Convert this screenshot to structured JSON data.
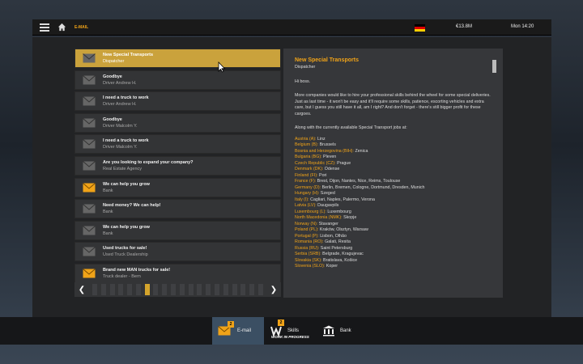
{
  "topbar": {
    "breadcrumb": "E-MAIL",
    "money": "€13.8M",
    "time": "Mon 14:20",
    "flag_colors": [
      "#000000",
      "#dd0000",
      "#ffce00"
    ]
  },
  "messages": [
    {
      "subject": "New Special Transports",
      "from": "Dispatcher",
      "status": "read",
      "selected": true
    },
    {
      "subject": "Goodbye",
      "from": "Driver Andrew H.",
      "status": "read"
    },
    {
      "subject": "I need a truck to work",
      "from": "Driver Andrew H.",
      "status": "read"
    },
    {
      "subject": "Goodbye",
      "from": "Driver Malcolm Y.",
      "status": "read"
    },
    {
      "subject": "I need a truck to work",
      "from": "Driver Malcolm Y.",
      "status": "read"
    },
    {
      "subject": "Are you looking to expand your company?",
      "from": "Real Estate Agency",
      "status": "read"
    },
    {
      "subject": "We can help you grow",
      "from": "Bank",
      "status": "new"
    },
    {
      "subject": "Need money? We can help!",
      "from": "Bank",
      "status": "read"
    },
    {
      "subject": "We can help you grow",
      "from": "Bank",
      "status": "read"
    },
    {
      "subject": "Used trucks for sale!",
      "from": "Used Truck Dealership",
      "status": "read"
    },
    {
      "subject": "Brand new MAN trucks for sale!",
      "from": "Truck dealer - Bern",
      "status": "new"
    }
  ],
  "pager": {
    "page_count": 20,
    "active_page": 6
  },
  "reader": {
    "title": "New Special Transports",
    "sender": "Dispatcher",
    "greeting": "Hi boss.",
    "body": "More companies would like to hire your professional skills behind the wheel for some special deliveries. Just as last time - it won't be easy and it'll require some skills, patience, escorting vehicles and extra care, but I guess you still have it all, am I right? And don't forget - there's still bigger profit for these cargoes.",
    "jobs_intro": "Along with the currently available Special Transport jobs at:",
    "jobs": [
      {
        "country": "Austria (A):",
        "cities": " Linz"
      },
      {
        "country": "Belgium (B):",
        "cities": " Brussels"
      },
      {
        "country": "Bosnia and Herzegovina (BIH):",
        "cities": " Zenica"
      },
      {
        "country": "Bulgaria (BG):",
        "cities": " Pleven"
      },
      {
        "country": "Czech Republic (CZ):",
        "cities": " Prague"
      },
      {
        "country": "Denmark (DK):",
        "cities": " Odense"
      },
      {
        "country": "Finland (FI):",
        "cities": " Pori"
      },
      {
        "country": "France (F):",
        "cities": " Brest, Dijon, Nantes, Nice, Reims, Toulouse"
      },
      {
        "country": "Germany (D):",
        "cities": " Berlin, Bremen, Cologne, Dortmund, Dresden, Munich"
      },
      {
        "country": "Hungary (H):",
        "cities": " Szeged"
      },
      {
        "country": "Italy (I):",
        "cities": " Cagliari, Naples, Palermo, Verona"
      },
      {
        "country": "Latvia (LV):",
        "cities": " Daugavpils"
      },
      {
        "country": "Luxembourg (L):",
        "cities": " Luxembourg"
      },
      {
        "country": "North Macedonia (NMK):",
        "cities": " Skopje"
      },
      {
        "country": "Norway (N):",
        "cities": " Stavanger"
      },
      {
        "country": "Poland (PL):",
        "cities": " Kraków, Olsztyn, Warsaw"
      },
      {
        "country": "Portugal (P):",
        "cities": " Lisbon, Olhão"
      },
      {
        "country": "Romania (RO):",
        "cities": " Galati, Resita"
      },
      {
        "country": "Russia (RU):",
        "cities": " Saint Petersburg"
      },
      {
        "country": "Serbia (SRB):",
        "cities": " Belgrade, Kragujevac"
      },
      {
        "country": "Slovakia (SK):",
        "cities": " Bratislava, Košice"
      },
      {
        "country": "Slovenia (SLO):",
        "cities": " Koper"
      }
    ]
  },
  "nav": {
    "email": {
      "label": "E-mail",
      "badge": "2"
    },
    "skills": {
      "label": "Skills",
      "badge": "2",
      "note": "WORK IN PROGRESS"
    },
    "bank": {
      "label": "Bank"
    }
  },
  "colors": {
    "accent": "#f0a318",
    "selected": "#caa23c",
    "active_tab": "#3b4f63"
  }
}
